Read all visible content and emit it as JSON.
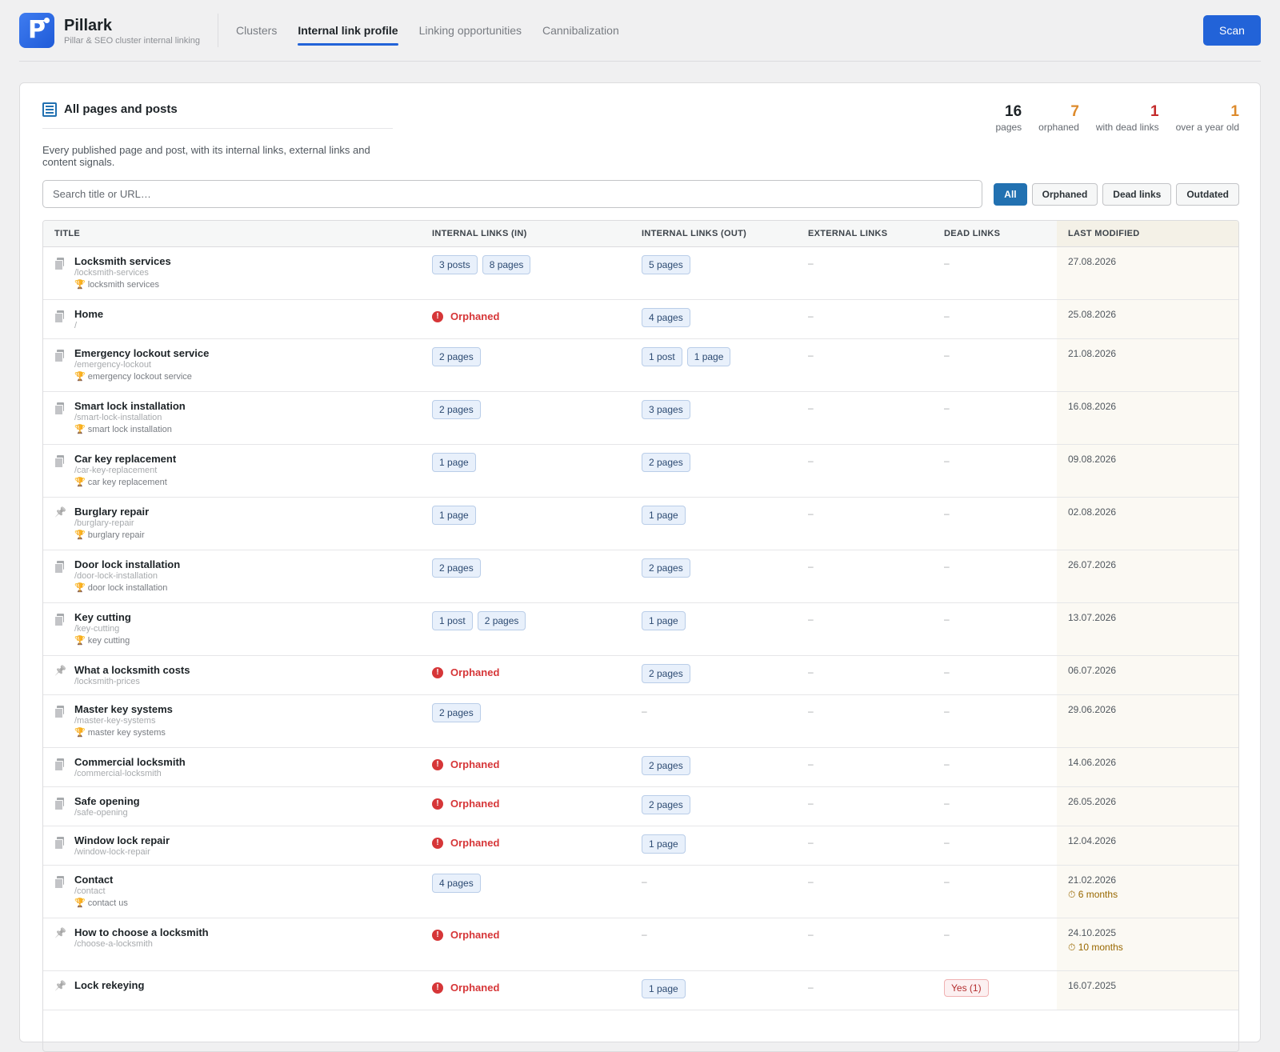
{
  "app": {
    "name": "Pillark",
    "subtitle": "Pillar & SEO cluster internal linking",
    "logo_letter": "P",
    "accent": "#2263d8"
  },
  "nav": {
    "tabs": [
      {
        "label": "Clusters",
        "active": false
      },
      {
        "label": "Internal link profile",
        "active": true
      },
      {
        "label": "Linking opportunities",
        "active": false
      },
      {
        "label": "Cannibalization",
        "active": false
      }
    ],
    "scan_label": "Scan"
  },
  "card": {
    "title": "All pages and posts",
    "icon": "list-icon",
    "description": "Every published page and post, with its internal links, external links and content signals."
  },
  "stats": [
    {
      "value": "16",
      "label": "pages",
      "color": "#1d2327"
    },
    {
      "value": "7",
      "label": "orphaned",
      "color": "#dd8a2b"
    },
    {
      "value": "1",
      "label": "with dead links",
      "color": "#c42b2b"
    },
    {
      "value": "1",
      "label": "over a year old",
      "color": "#dd8a2b"
    }
  ],
  "search": {
    "placeholder": "Search title or URL…",
    "value": ""
  },
  "filters": [
    {
      "label": "All",
      "active": true
    },
    {
      "label": "Orphaned",
      "active": false
    },
    {
      "label": "Dead links",
      "active": false
    },
    {
      "label": "Outdated",
      "active": false
    }
  ],
  "table": {
    "columns": [
      "Title",
      "Internal links (in)",
      "Internal links (out)",
      "External links",
      "Dead links",
      "Last modified"
    ],
    "rows": [
      {
        "type": "page",
        "title": "Locksmith services",
        "url": "/locksmith-services",
        "keyword": "locksmith services",
        "in": [
          "3 posts",
          "8 pages"
        ],
        "orphaned": false,
        "out": [
          "5 pages"
        ],
        "external": "–",
        "dead": "–",
        "modified": "27.08.2026",
        "age": ""
      },
      {
        "type": "page",
        "title": "Home",
        "url": "/",
        "keyword": "",
        "in": [],
        "orphaned": true,
        "out": [
          "4 pages"
        ],
        "external": "–",
        "dead": "–",
        "modified": "25.08.2026",
        "age": ""
      },
      {
        "type": "page",
        "title": "Emergency lockout service",
        "url": "/emergency-lockout",
        "keyword": "emergency lockout service",
        "in": [
          "2 pages"
        ],
        "orphaned": false,
        "out": [
          "1 post",
          "1 page"
        ],
        "external": "–",
        "dead": "–",
        "modified": "21.08.2026",
        "age": ""
      },
      {
        "type": "page",
        "title": "Smart lock installation",
        "url": "/smart-lock-installation",
        "keyword": "smart lock installation",
        "in": [
          "2 pages"
        ],
        "orphaned": false,
        "out": [
          "3 pages"
        ],
        "external": "–",
        "dead": "–",
        "modified": "16.08.2026",
        "age": ""
      },
      {
        "type": "page",
        "title": "Car key replacement",
        "url": "/car-key-replacement",
        "keyword": "car key replacement",
        "in": [
          "1 page"
        ],
        "orphaned": false,
        "out": [
          "2 pages"
        ],
        "external": "–",
        "dead": "–",
        "modified": "09.08.2026",
        "age": ""
      },
      {
        "type": "post",
        "title": "Burglary repair",
        "url": "/burglary-repair",
        "keyword": "burglary repair",
        "in": [
          "1 page"
        ],
        "orphaned": false,
        "out": [
          "1 page"
        ],
        "external": "–",
        "dead": "–",
        "modified": "02.08.2026",
        "age": ""
      },
      {
        "type": "page",
        "title": "Door lock installation",
        "url": "/door-lock-installation",
        "keyword": "door lock installation",
        "in": [
          "2 pages"
        ],
        "orphaned": false,
        "out": [
          "2 pages"
        ],
        "external": "–",
        "dead": "–",
        "modified": "26.07.2026",
        "age": ""
      },
      {
        "type": "page",
        "title": "Key cutting",
        "url": "/key-cutting",
        "keyword": "key cutting",
        "in": [
          "1 post",
          "2 pages"
        ],
        "orphaned": false,
        "out": [
          "1 page"
        ],
        "external": "–",
        "dead": "–",
        "modified": "13.07.2026",
        "age": ""
      },
      {
        "type": "post",
        "title": "What a locksmith costs",
        "url": "/locksmith-prices",
        "keyword": "",
        "in": [],
        "orphaned": true,
        "out": [
          "2 pages"
        ],
        "external": "–",
        "dead": "–",
        "modified": "06.07.2026",
        "age": ""
      },
      {
        "type": "page",
        "title": "Master key systems",
        "url": "/master-key-systems",
        "keyword": "master key systems",
        "in": [
          "2 pages"
        ],
        "orphaned": false,
        "out": [],
        "external": "–",
        "dead": "–",
        "modified": "29.06.2026",
        "age": ""
      },
      {
        "type": "page",
        "title": "Commercial locksmith",
        "url": "/commercial-locksmith",
        "keyword": "",
        "in": [],
        "orphaned": true,
        "out": [
          "2 pages"
        ],
        "external": "–",
        "dead": "–",
        "modified": "14.06.2026",
        "age": ""
      },
      {
        "type": "page",
        "title": "Safe opening",
        "url": "/safe-opening",
        "keyword": "",
        "in": [],
        "orphaned": true,
        "out": [
          "2 pages"
        ],
        "external": "–",
        "dead": "–",
        "modified": "26.05.2026",
        "age": ""
      },
      {
        "type": "page",
        "title": "Window lock repair",
        "url": "/window-lock-repair",
        "keyword": "",
        "in": [],
        "orphaned": true,
        "out": [
          "1 page"
        ],
        "external": "–",
        "dead": "–",
        "modified": "12.04.2026",
        "age": ""
      },
      {
        "type": "page",
        "title": "Contact",
        "url": "/contact",
        "keyword": "contact us",
        "in": [
          "4 pages"
        ],
        "orphaned": false,
        "out": [],
        "external": "–",
        "dead": "–",
        "modified": "21.02.2026",
        "age": "6 months"
      },
      {
        "type": "post",
        "title": "How to choose a locksmith",
        "url": "/choose-a-locksmith",
        "keyword": "",
        "in": [],
        "orphaned": true,
        "out": [],
        "external": "–",
        "dead": "–",
        "modified": "24.10.2025",
        "age": "10 months"
      },
      {
        "type": "post",
        "title": "Lock rekeying",
        "url": "",
        "keyword": "",
        "in": [],
        "orphaned": true,
        "out": [
          "1 page"
        ],
        "external": "–",
        "dead": "Yes (1)",
        "modified": "16.07.2025",
        "age": ""
      }
    ],
    "orphaned_label": "Orphaned",
    "empty_mark": "–"
  }
}
